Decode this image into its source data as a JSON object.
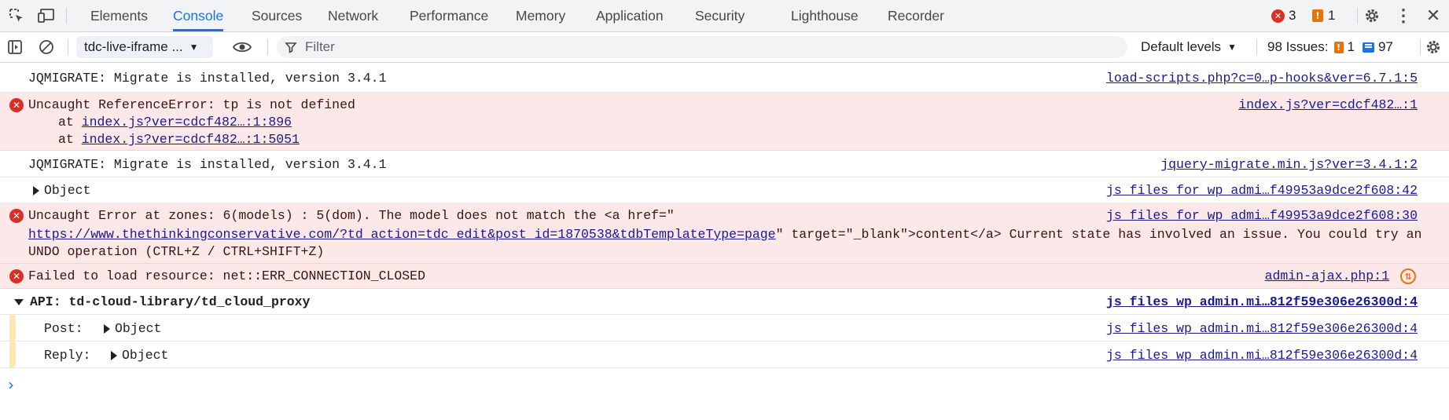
{
  "tabs": [
    {
      "label": "Elements"
    },
    {
      "label": "Console"
    },
    {
      "label": "Sources"
    },
    {
      "label": "Network"
    },
    {
      "label": "Performance"
    },
    {
      "label": "Memory"
    },
    {
      "label": "Application"
    },
    {
      "label": "Security"
    },
    {
      "label": "Lighthouse"
    },
    {
      "label": "Recorder"
    }
  ],
  "header": {
    "errors_count": "3",
    "warnings_count": "1"
  },
  "toolbar": {
    "context": "tdc-live-iframe ...",
    "filter_placeholder": "Filter",
    "levels": "Default levels",
    "issues_label": "98 Issues:",
    "issues_warn": "1",
    "issues_info": "97"
  },
  "messages": [
    {
      "text": "JQMIGRATE: Migrate is installed, version 3.4.1",
      "source": "load-scripts.php?c=0…p-hooks&ver=6.7.1:5"
    },
    {
      "text": "Uncaught ReferenceError: tp is not defined",
      "source": "index.js?ver=cdcf482…:1",
      "at_prefix": "at",
      "stack": [
        "index.js?ver=cdcf482…:1:896",
        "index.js?ver=cdcf482…:1:5051"
      ]
    },
    {
      "text": "JQMIGRATE: Migrate is installed, version 3.4.1",
      "source": "jquery-migrate.min.js?ver=3.4.1:2"
    },
    {
      "text": "Object",
      "source": "js_files_for_wp_admi…f49953a9dce2f608:42"
    },
    {
      "text1": "Uncaught Error at zones: 6(models) : 5(dom). The model does not match the <a href=\"",
      "url": "https://www.thethinkingconservative.com/?td_action=tdc_edit&post_id=1870538&tdbTemplateType=page",
      "text2": "\" target=\"_blank\">content</a> Current state has involved an issue. You could try an",
      "text3": "UNDO operation (CTRL+Z / CTRL+SHIFT+Z)",
      "source": "js_files_for_wp_admi…f49953a9dce2f608:30"
    },
    {
      "text": "Failed to load resource: net::ERR_CONNECTION_CLOSED",
      "source": "admin-ajax.php:1"
    },
    {
      "text": "API: td-cloud-library/td_cloud_proxy",
      "source": "js_files_wp_admin.mi…812f59e306e26300d:4"
    },
    {
      "label": "Post:",
      "value": "Object",
      "source": "js_files_wp_admin.mi…812f59e306e26300d:4"
    },
    {
      "label": "Reply:",
      "value": "Object",
      "source": "js_files_wp_admin.mi…812f59e306e26300d:4"
    }
  ]
}
